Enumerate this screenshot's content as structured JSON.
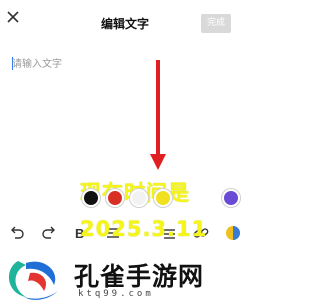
{
  "header": {
    "title": "编辑文字",
    "done_label": "完成",
    "close_icon": "close-icon"
  },
  "editor": {
    "placeholder": "请输入文字"
  },
  "overlay": {
    "line1": "现在时间是",
    "line2": "2025.3.11",
    "color": "#f5f519"
  },
  "palette": {
    "colors": [
      "#111111",
      "#d93025",
      "#f2f2f2",
      "#f0e020",
      "#6a4bd6"
    ]
  },
  "toolbar": {
    "icons": [
      "undo-icon",
      "redo-icon",
      "bold-icon",
      "align-icon",
      "list-icon",
      "link-icon",
      "color-picker-icon"
    ]
  },
  "watermark": {
    "brand": "孔雀手游网",
    "url": "ktq99.com",
    "colors": {
      "teal": "#1fb39a",
      "blue": "#1f6fd6",
      "red": "#e3342f"
    }
  },
  "annotation": {
    "arrow_color": "#e02020"
  }
}
